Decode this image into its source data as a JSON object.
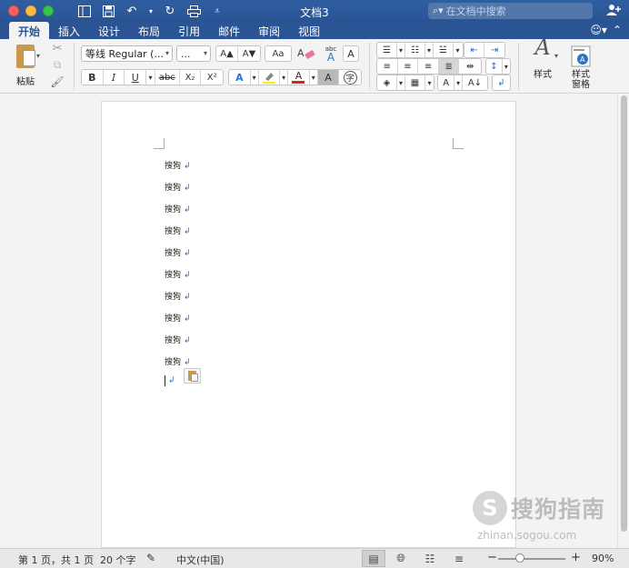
{
  "window": {
    "title": "文档3",
    "search_placeholder": "在文档中搜索"
  },
  "tabs": [
    {
      "label": "开始",
      "active": true
    },
    {
      "label": "插入"
    },
    {
      "label": "设计"
    },
    {
      "label": "布局"
    },
    {
      "label": "引用"
    },
    {
      "label": "邮件"
    },
    {
      "label": "审阅"
    },
    {
      "label": "视图"
    }
  ],
  "ribbon": {
    "paste_label": "粘贴",
    "font_name": "等线 Regular (...",
    "font_size": "...",
    "styles_label": "样式",
    "styles_pane_label_1": "样式",
    "styles_pane_label_2": "窗格",
    "bold": "B",
    "italic": "I",
    "underline": "U",
    "strike": "abc",
    "subscript": "X₂",
    "superscript": "X²",
    "grow": "A▲",
    "shrink": "A▼",
    "case": "Aa",
    "clear_fmt_text": "abc",
    "border_char": "A",
    "shade_char": "A",
    "phonetic": "字"
  },
  "document": {
    "lines": [
      "搜狗",
      "搜狗",
      "搜狗",
      "搜狗",
      "搜狗",
      "搜狗",
      "搜狗",
      "搜狗",
      "搜狗",
      "搜狗"
    ],
    "para_mark": "↲"
  },
  "status": {
    "page": "第 1 页，共 1 页",
    "words": "20 个字",
    "language": "中文(中国)",
    "zoom": "90%",
    "zoom_fraction": 0.33
  },
  "watermark": {
    "brand": "搜狗指南",
    "url": "zhinan.sogou.com"
  },
  "colors": {
    "brand_blue": "#2a5494",
    "highlight_yellow": "#ffee00",
    "font_red": "#e02020"
  }
}
